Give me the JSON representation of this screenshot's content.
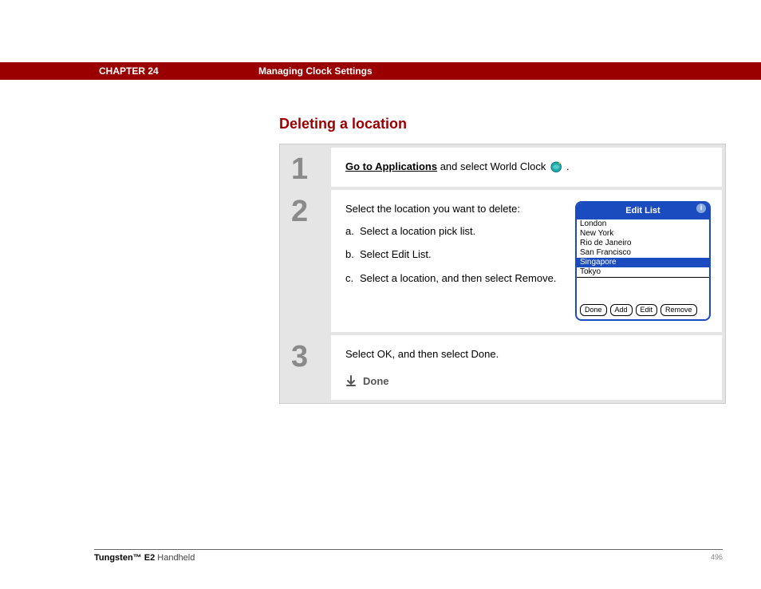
{
  "header": {
    "chapter": "CHAPTER 24",
    "topic": "Managing Clock Settings"
  },
  "section_title": "Deleting a location",
  "steps": {
    "s1": {
      "num": "1",
      "link_text": "Go to Applications",
      "rest": " and select World Clock ",
      "period": "."
    },
    "s2": {
      "num": "2",
      "intro": "Select the location you want to delete:",
      "a": "Select a location pick list.",
      "b": "Select Edit List.",
      "c": "Select a location, and then select Remove."
    },
    "s3": {
      "num": "3",
      "text": "Select OK, and then select Done.",
      "done_label": "Done"
    }
  },
  "palm": {
    "title": "Edit List",
    "items": [
      "London",
      "New York",
      "Rio de Janeiro",
      "San Francisco",
      "Singapore",
      "Tokyo"
    ],
    "selected_index": 4,
    "buttons": {
      "done": "Done",
      "add": "Add",
      "edit": "Edit",
      "remove": "Remove"
    }
  },
  "footer": {
    "product_bold": "Tungsten™ E2",
    "product_rest": " Handheld",
    "page": "496"
  }
}
